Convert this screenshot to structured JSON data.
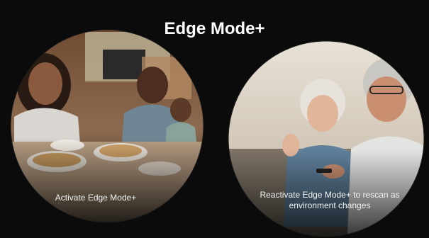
{
  "slide": {
    "title": "Edge Mode+",
    "left_panel": {
      "caption": "Activate Edge Mode+",
      "image": "family-dinner-photo"
    },
    "right_panel": {
      "caption": "Reactivate Edge Mode+ to rescan as environment changes",
      "image": "couple-watching-tv-photo"
    }
  },
  "colors": {
    "background": "#0b0b0c",
    "title": "#ffffff",
    "caption": "#f2f2f2"
  }
}
